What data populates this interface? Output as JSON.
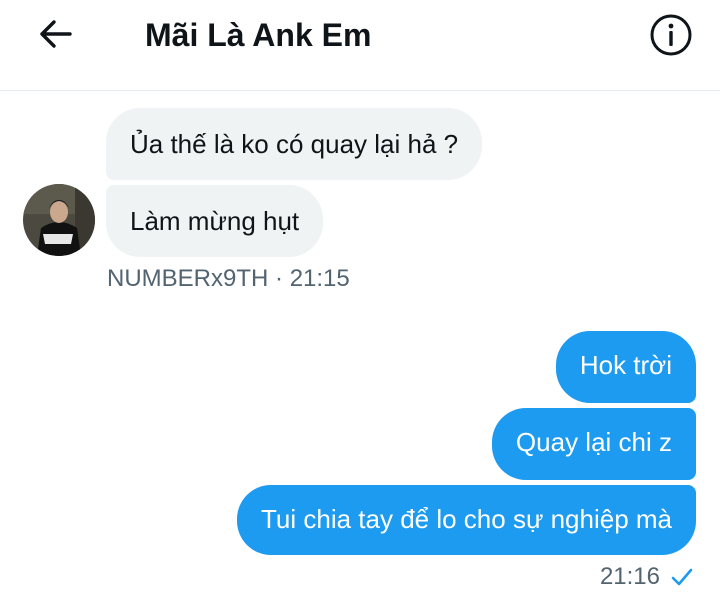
{
  "header": {
    "title": "Mãi Là Ank Em",
    "back_icon": "arrow-left-icon",
    "info_icon": "info-icon"
  },
  "conversation": {
    "received": {
      "messages": [
        {
          "text": "Ủa thế là ko có quay lại hả ?"
        },
        {
          "text": "Làm mừng hụt"
        }
      ],
      "sender": "NUMBERx9TH",
      "separator": "·",
      "time": "21:15"
    },
    "sent": {
      "messages": [
        {
          "text": "Hok trời"
        },
        {
          "text": "Quay lại chi z"
        },
        {
          "text": "Tui chia tay để lo cho sự nghiệp mà"
        }
      ],
      "time": "21:16",
      "status_icon": "check-icon"
    }
  },
  "colors": {
    "accent": "#1d9bf0",
    "received_bubble": "#eff3f4",
    "text": "#0f1419",
    "muted": "#536471"
  }
}
